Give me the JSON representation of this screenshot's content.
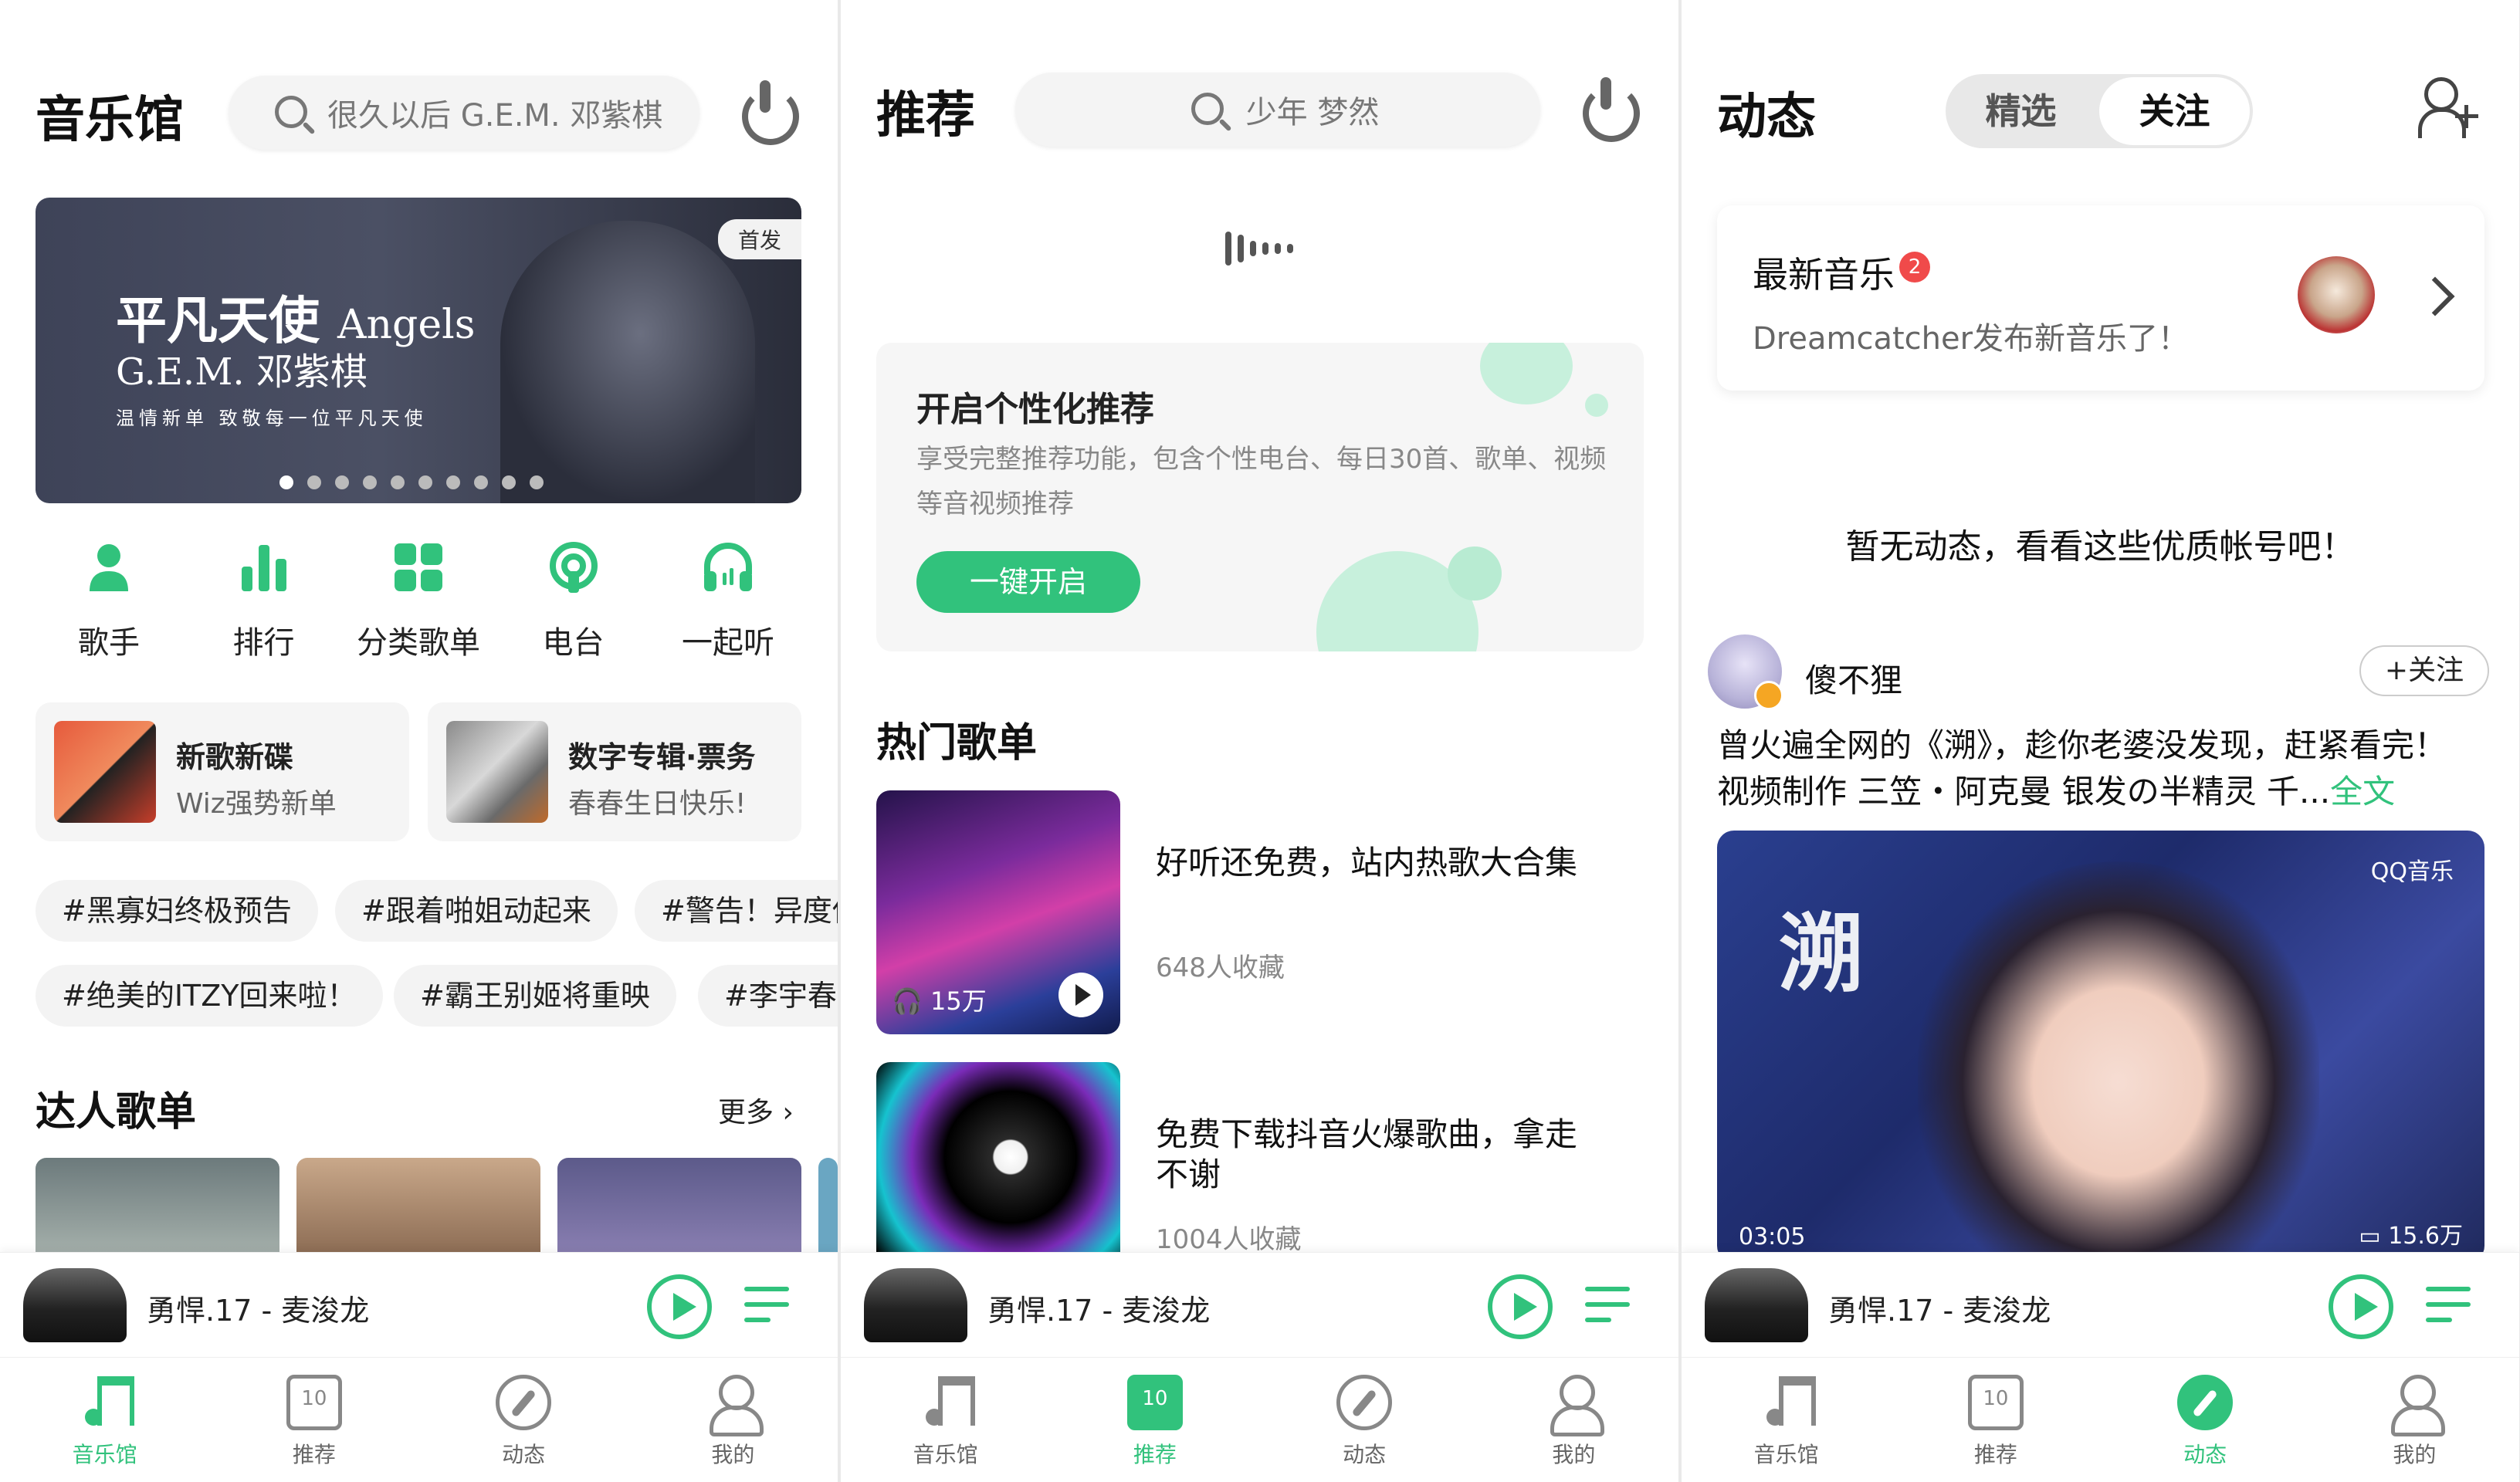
{
  "colors": {
    "accent": "#31c27c",
    "badge": "#f04a4a"
  },
  "player": {
    "song": "勇悍.17 - 麦浚龙"
  },
  "nav": {
    "items": [
      "音乐馆",
      "推荐",
      "动态",
      "我的"
    ],
    "calendar_day": "10"
  },
  "screen1": {
    "title": "音乐馆",
    "search_placeholder": "很久以后 G.E.M. 邓紫棋",
    "banner": {
      "tag": "首发",
      "title": "平凡天使",
      "title_en": "Angels",
      "artist": "G.E.M. 邓紫棋",
      "slogan": "温情新单 致敬每一位平凡天使",
      "page_count": 10,
      "active_page": 1
    },
    "categories": [
      {
        "label": "歌手",
        "icon": "singer-icon"
      },
      {
        "label": "排行",
        "icon": "chart-icon"
      },
      {
        "label": "分类歌单",
        "icon": "grid-icon"
      },
      {
        "label": "电台",
        "icon": "radio-icon"
      },
      {
        "label": "一起听",
        "icon": "headphones-icon"
      }
    ],
    "cards": [
      {
        "title": "新歌新碟",
        "subtitle": "Wiz强势新单"
      },
      {
        "title": "数字专辑·票务",
        "subtitle": "春春生日快乐!"
      }
    ],
    "chips_row1": [
      "#黑寡妇终极预告",
      "#跟着啪姐动起来",
      "#警告！异度侵"
    ],
    "chips_row2": [
      "#绝美的ITZY回来啦！",
      "#霸王别姬将重映",
      "#李宇春"
    ],
    "section_title": "达人歌单",
    "more": "更多"
  },
  "screen2": {
    "title": "推荐",
    "search_placeholder": "少年 梦然",
    "personal": {
      "title": "开启个性化推荐",
      "desc": "享受完整推荐功能，包含个性电台、每日30首、歌单、视频等音视频推荐",
      "button": "一键开启"
    },
    "section_title": "热门歌单",
    "playlists": [
      {
        "title": "好听还免费，站内热歌大合集",
        "subtitle": "648人收藏",
        "plays": "15万"
      },
      {
        "title": "免费下载抖音火爆歌曲，拿走不谢",
        "subtitle": "1004人收藏"
      }
    ]
  },
  "screen3": {
    "title": "动态",
    "tabs": [
      "精选",
      "关注"
    ],
    "active_tab": "关注",
    "news": {
      "title": "最新音乐",
      "badge": "2",
      "subtitle": "Dreamcatcher发布新音乐了！"
    },
    "empty_text": "暂无动态，看看这些优质帐号吧！",
    "user": {
      "name": "傻不狸",
      "follow": "+关注"
    },
    "post_line1": "曾火遍全网的《溯》，趁你老婆没发现，赶紧看完！",
    "post_line2": "视频制作 三笠・阿克曼 银发の半精灵 千...",
    "post_more": "全文",
    "video": {
      "caption": "溯",
      "brand": "QQ音乐",
      "duration": "03:05",
      "views": "15.6万"
    }
  }
}
